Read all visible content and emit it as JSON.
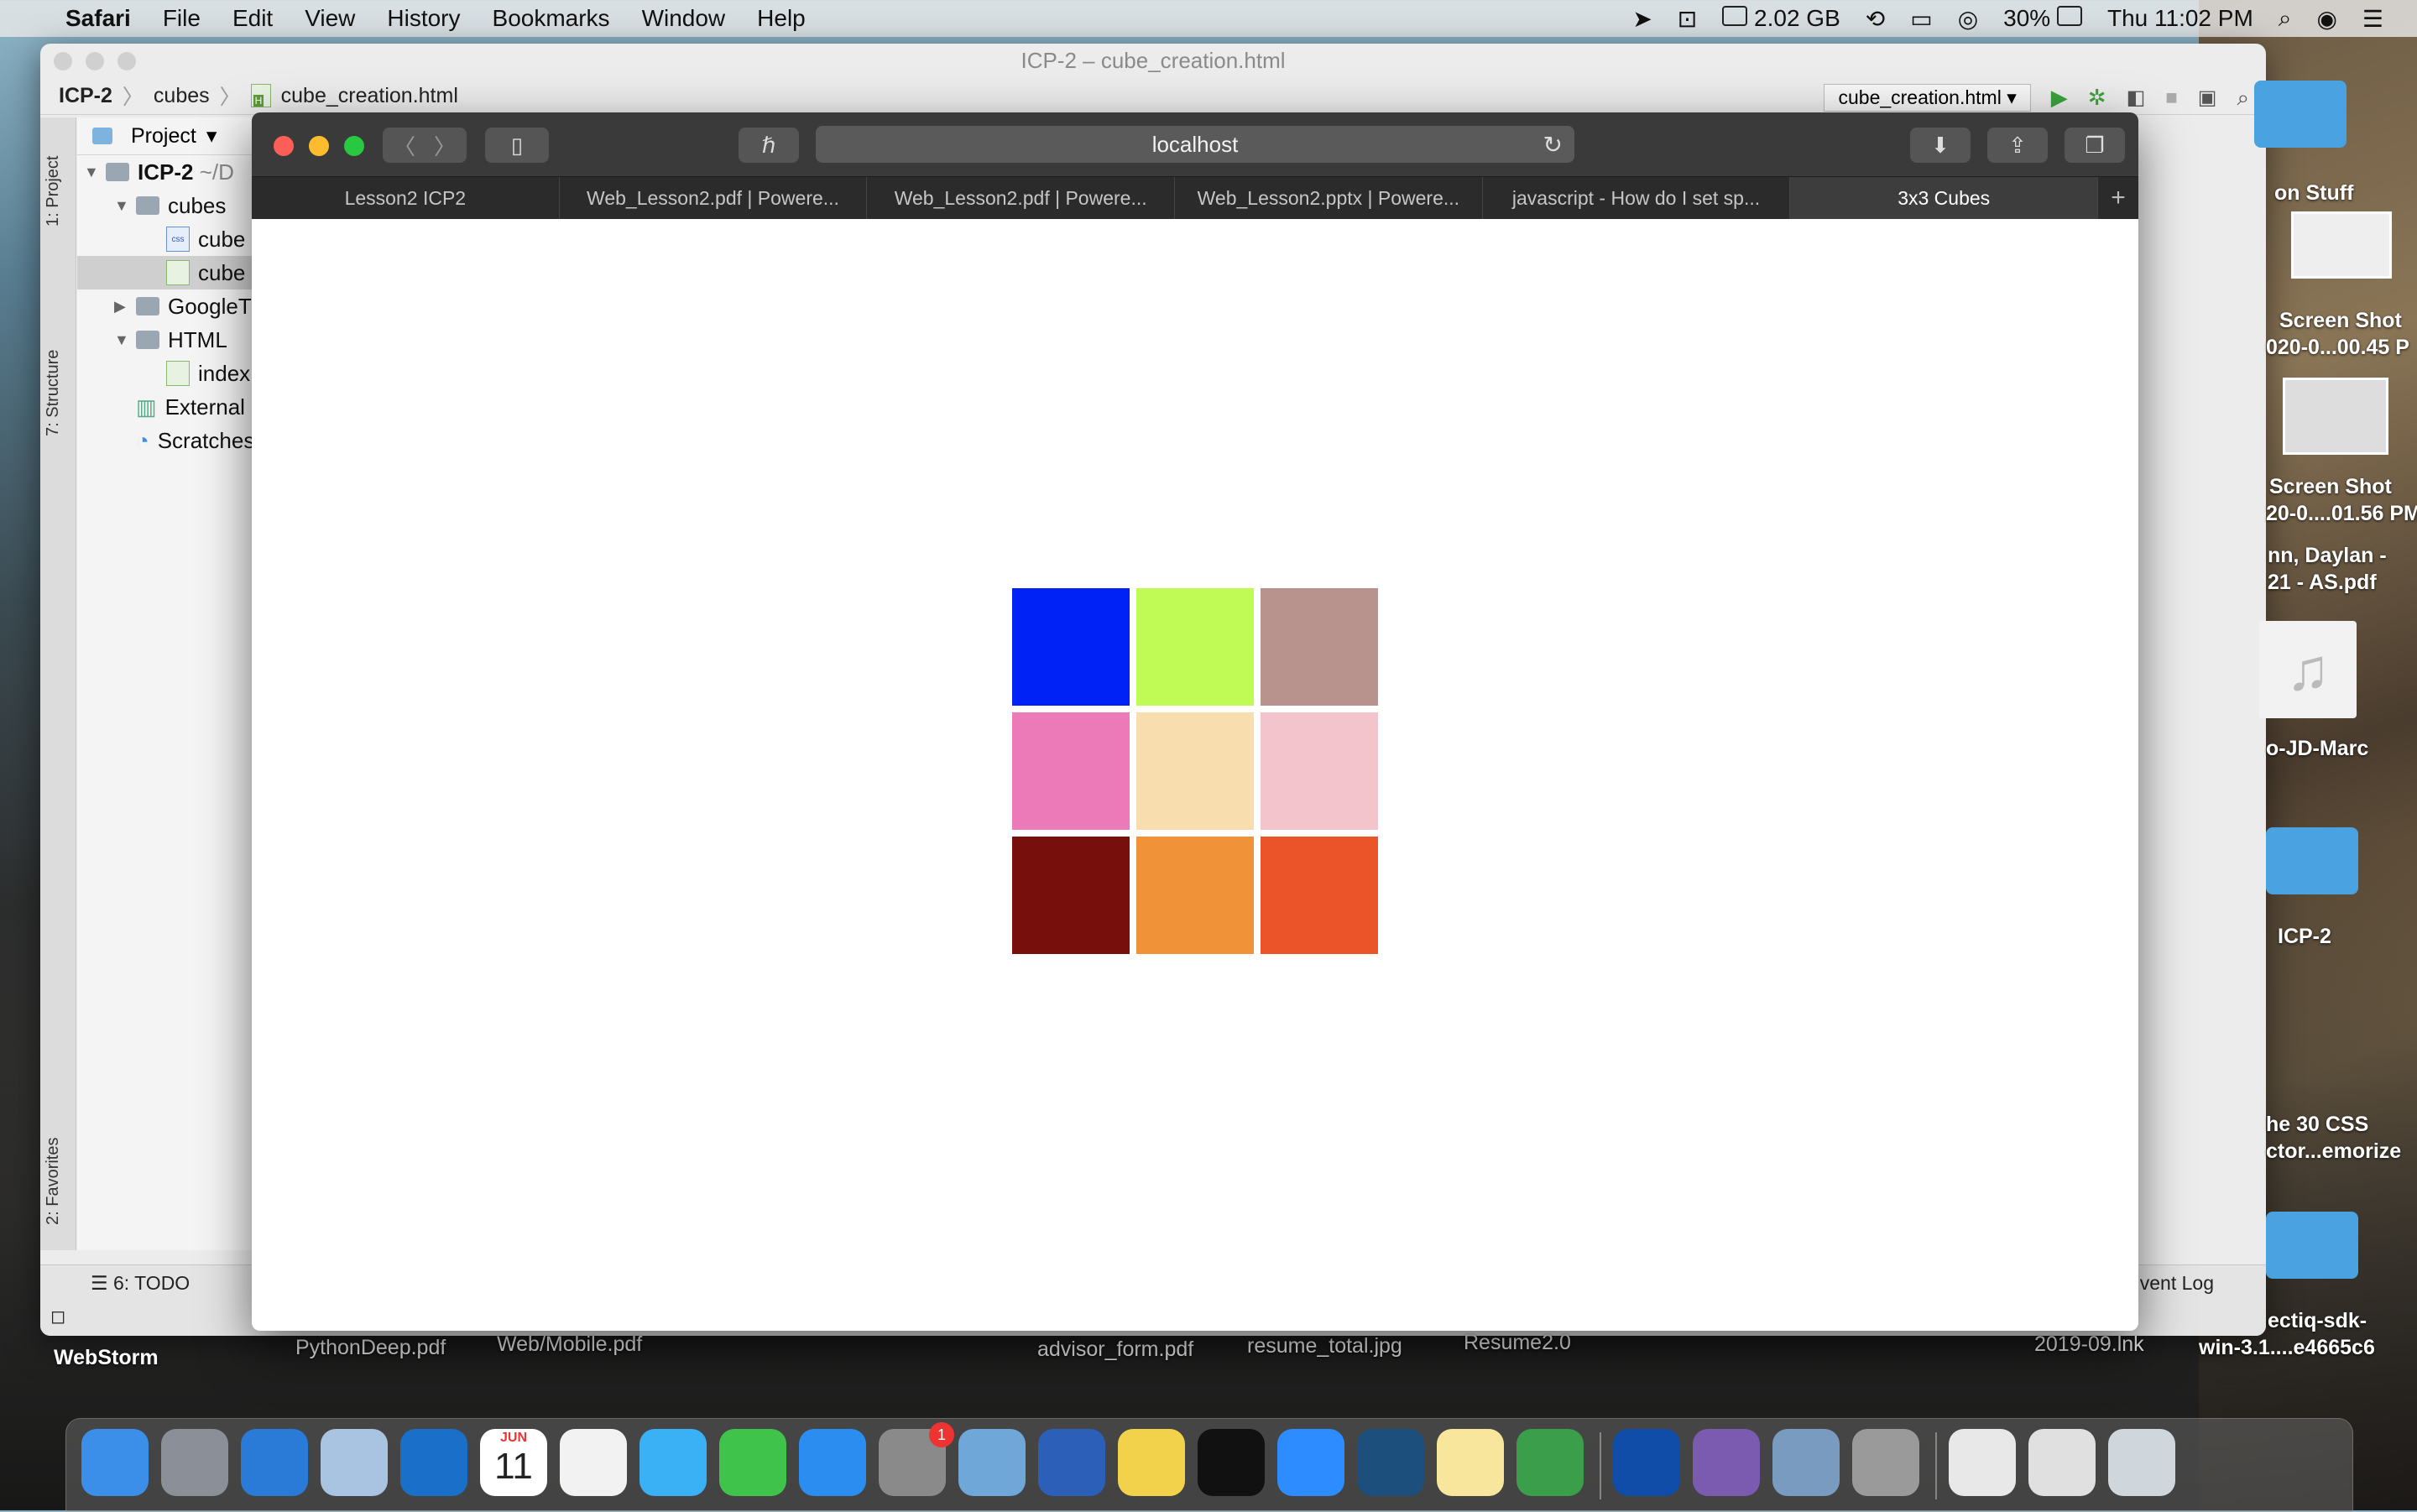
{
  "menubar": {
    "app": "Safari",
    "items": [
      "File",
      "Edit",
      "View",
      "History",
      "Bookmarks",
      "Window",
      "Help"
    ],
    "memory": "2.02 GB",
    "battery": "30%",
    "clock": "Thu 11:02 PM"
  },
  "webstorm": {
    "title": "ICP-2 – cube_creation.html",
    "breadcrumb": [
      "ICP-2",
      "cubes",
      "cube_creation.html"
    ],
    "run_config": "cube_creation.html",
    "project_label": "Project",
    "side_tabs": [
      "1: Project",
      "7: Structure",
      "2: Favorites"
    ],
    "tree": [
      {
        "label": "ICP-2",
        "suffix": "~/D",
        "type": "folder",
        "bold": true
      },
      {
        "label": "cubes",
        "type": "folder"
      },
      {
        "label": "cube",
        "type": "css"
      },
      {
        "label": "cube",
        "type": "html"
      },
      {
        "label": "GoogleT",
        "type": "folder"
      },
      {
        "label": "HTML",
        "type": "folder"
      },
      {
        "label": "index",
        "type": "html"
      },
      {
        "label": "External Li",
        "type": "lib"
      },
      {
        "label": "Scratches",
        "type": "scratch"
      }
    ],
    "todo": "6: TODO",
    "event_log": "vent Log"
  },
  "safari": {
    "address": "localhost",
    "tabs": [
      "Lesson2 ICP2",
      "Web_Lesson2.pdf | Powere...",
      "Web_Lesson2.pdf | Powere...",
      "Web_Lesson2.pptx | Powere...",
      "javascript - How do I set sp...",
      "3x3 Cubes"
    ],
    "active_tab": 5
  },
  "cubes": {
    "colors": [
      "#0022f6",
      "#c0fa54",
      "#b8938e",
      "#ed7ab8",
      "#f8deae",
      "#f4c4cc",
      "#77100c",
      "#f09338",
      "#ea5428"
    ]
  },
  "desktop": {
    "labels": [
      "on Stuff",
      "Screen Shot",
      "020-0...00.45 P",
      "Screen Shot",
      "20-0....01.56 PM",
      "nn, Daylan -",
      "21 - AS.pdf",
      "o-JD-Marc",
      "ICP-2",
      "he 30 CSS",
      "ctor...emorize",
      "ectiq-sdk-",
      "win-3.1....e4665c6"
    ],
    "bottom_files": [
      "WebStorm",
      "PythonDeep.pdf",
      "Web/Mobile.pdf",
      "advisor_form.pdf",
      "resume_total.jpg",
      "Resume2.0",
      "2019-09.lnk"
    ]
  },
  "dock": {
    "calendar_month": "JUN",
    "calendar_day": "11",
    "settings_badge": "1",
    "apps": [
      "finder",
      "launchpad",
      "safari",
      "preview",
      "outlook",
      "calendar",
      "photos",
      "messages",
      "facetime",
      "app-store",
      "system-preferences",
      "remote-desktop",
      "word",
      "python",
      "pycharm",
      "zoom",
      "mysql-workbench",
      "notes",
      "app",
      "webstorm",
      "github",
      "preview-image",
      "memory-clean",
      "pdf-doc",
      "screens",
      "trash"
    ]
  }
}
